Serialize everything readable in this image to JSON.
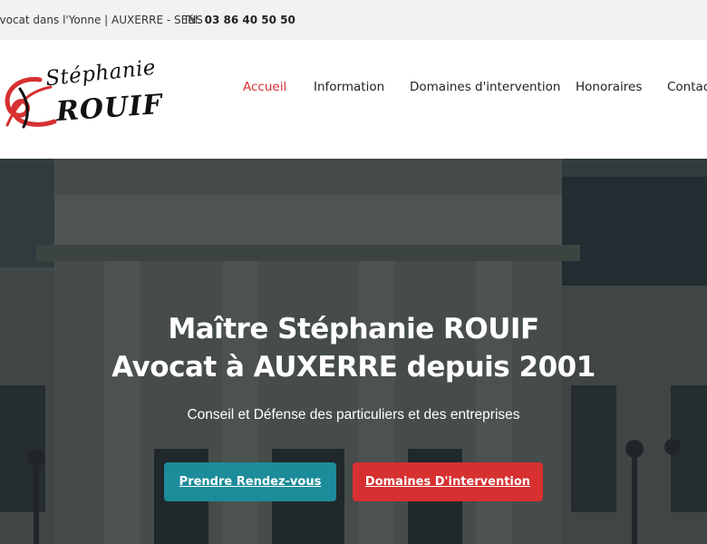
{
  "topbar": {
    "tagline": "Avocat dans l'Yonne | AUXERRE - SENS",
    "phone_label": "Tél.",
    "phone_number": "03 86 40 50 50"
  },
  "logo": {
    "first_name": "Stéphanie",
    "last_name": "ROUIF",
    "monogram_color": "#d63031"
  },
  "nav": {
    "items": [
      {
        "label": "Accueil",
        "active": true
      },
      {
        "label": "Information",
        "active": false
      },
      {
        "label": "Domaines d'intervention",
        "active": false
      },
      {
        "label": "Honoraires",
        "active": false
      },
      {
        "label": "Contact",
        "active": false
      }
    ]
  },
  "hero": {
    "title_line1": "Maître Stéphanie ROUIF",
    "title_line2": "Avocat à AUXERRE depuis 2001",
    "subtitle": "Conseil et Défense des particuliers et des entreprises",
    "cta_primary": "Prendre Rendez-vous",
    "cta_secondary": "Domaines D'intervention"
  },
  "colors": {
    "accent_red": "#d63031",
    "accent_teal": "#1c8b9a",
    "topbar_bg": "#f2f2f2"
  }
}
